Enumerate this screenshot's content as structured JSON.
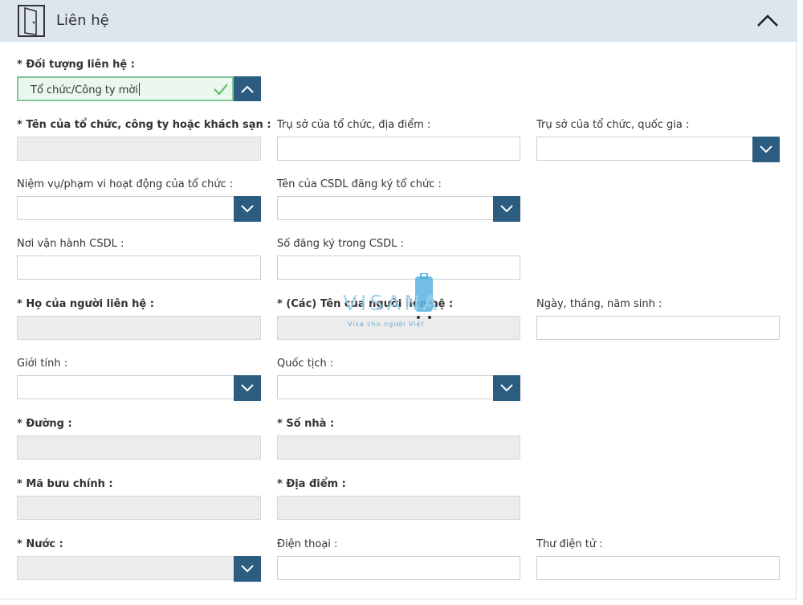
{
  "header": {
    "title": "Liên hệ",
    "icon": "door-icon",
    "toggle_icon": "chevron-up-icon"
  },
  "contact_type": {
    "label": "* Đối tượng liên hệ :",
    "value": "Tổ chức/Công ty mời"
  },
  "fields": {
    "org_name": {
      "label": "* Tên của tổ chức, công ty hoặc khách sạn :",
      "value": ""
    },
    "org_address": {
      "label": "Trụ sở của tổ chức, địa điểm :",
      "value": ""
    },
    "org_country": {
      "label": "Trụ sở của tổ chức, quốc gia :",
      "value": ""
    },
    "org_mission": {
      "label": "Niệm vụ/phạm vi hoạt động của tổ chức :",
      "value": ""
    },
    "db_name": {
      "label": "Tên của CSDL đăng ký tổ chức :",
      "value": ""
    },
    "db_location": {
      "label": "Nơi vận hành CSDL :",
      "value": ""
    },
    "db_number": {
      "label": "Số đăng ký trong CSDL :",
      "value": ""
    },
    "last_name": {
      "label": "* Họ của người liên hệ :",
      "value": ""
    },
    "first_names": {
      "label": "* (Các) Tên của người liên hệ :",
      "value": ""
    },
    "birth_date": {
      "label": "Ngày, tháng, năm sinh :",
      "value": ""
    },
    "gender": {
      "label": "Giới tính :",
      "value": ""
    },
    "nationality": {
      "label": "Quốc tịch :",
      "value": ""
    },
    "street": {
      "label": "* Đường :",
      "value": ""
    },
    "house_number": {
      "label": "* Số nhà :",
      "value": ""
    },
    "postal_code": {
      "label": "* Mã bưu chính :",
      "value": ""
    },
    "place": {
      "label": "* Địa điểm :",
      "value": ""
    },
    "country": {
      "label": "* Nước :",
      "value": ""
    },
    "phone": {
      "label": "Điện thoại :",
      "value": ""
    },
    "email": {
      "label": "Thư điện tử :",
      "value": ""
    }
  },
  "watermark": {
    "brand": "VISANA",
    "tagline": "Visa cho người Việt"
  },
  "colors": {
    "header_bg": "#dde6ee",
    "dropdown_button": "#2c5c80",
    "valid_border": "#7fc89a",
    "valid_check": "#4caf50",
    "disabled_field": "#ececec"
  }
}
